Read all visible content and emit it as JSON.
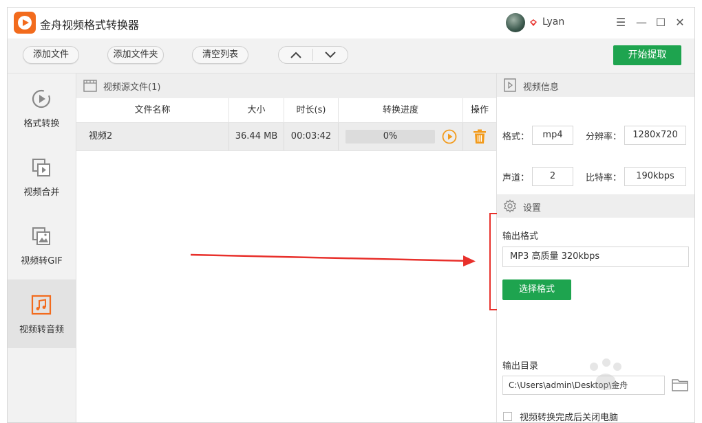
{
  "app": {
    "title": "金舟视频格式转换器"
  },
  "user": {
    "name": "Lyan"
  },
  "window_controls": {
    "menu": "☰",
    "minimize": "—",
    "maximize": "☐",
    "close": "✕"
  },
  "toolbar": {
    "add_file": "添加文件",
    "add_folder": "添加文件夹",
    "clear_list": "清空列表",
    "start": "开始提取"
  },
  "sidebar": {
    "items": [
      {
        "label": "格式转换",
        "icon": "convert-icon"
      },
      {
        "label": "视频合并",
        "icon": "merge-icon"
      },
      {
        "label": "视频转GIF",
        "icon": "gif-icon"
      },
      {
        "label": "视频转音频",
        "icon": "audio-icon",
        "active": true
      }
    ]
  },
  "file_list": {
    "header": "视频源文件(1)",
    "columns": [
      "文件名称",
      "大小",
      "时长(s)",
      "转换进度",
      "操作"
    ],
    "rows": [
      {
        "name": "视频2",
        "size": "36.44 MB",
        "duration": "00:03:42",
        "progress": "0%"
      }
    ]
  },
  "video_info": {
    "header": "视频信息",
    "format_label": "格式：",
    "format": "mp4",
    "resolution_label": "分辨率：",
    "resolution": "1280x720",
    "channels_label": "声道：",
    "channels": "2",
    "bitrate_label": "比特率：",
    "bitrate": "190kbps"
  },
  "settings": {
    "header": "设置",
    "output_format_label": "输出格式",
    "output_format": "MP3 高质量 320kbps",
    "select_format": "选择格式",
    "output_dir_label": "输出目录",
    "output_dir": "C:\\Users\\admin\\Desktop\\金舟",
    "close_after_label": "视频转换完成后关闭电脑"
  },
  "colors": {
    "accent": "#1ea44f",
    "brand": "#f26b1d",
    "annotation": "#e8302b"
  }
}
